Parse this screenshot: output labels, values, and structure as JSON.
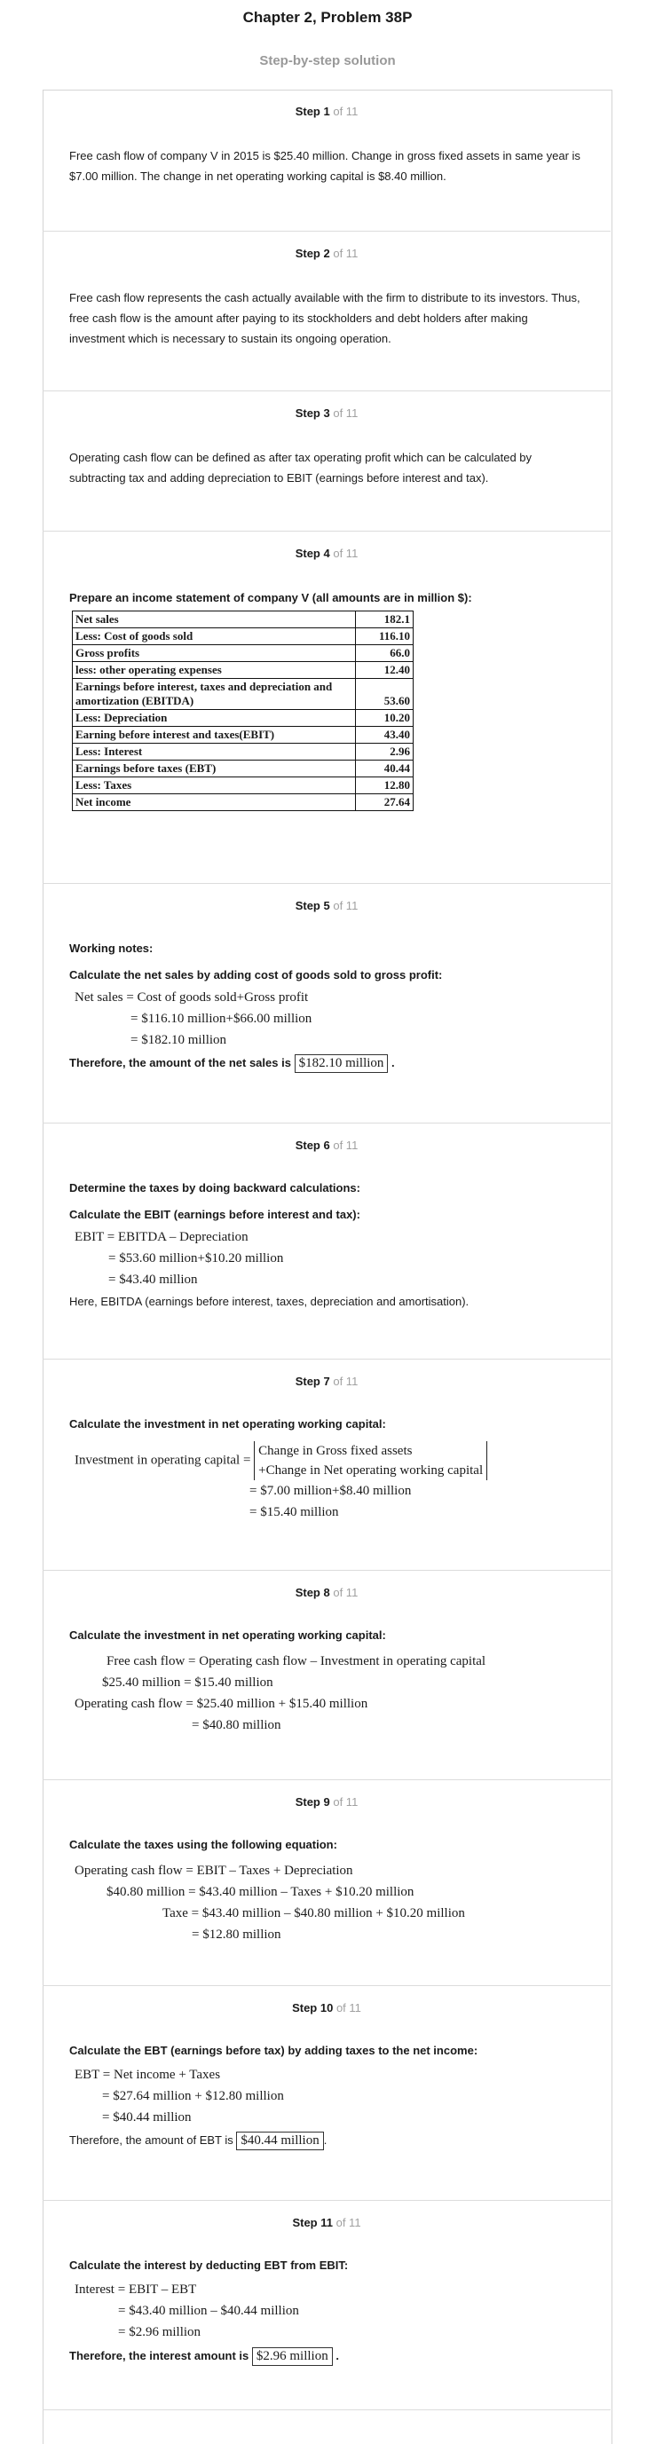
{
  "title": "Chapter 2, Problem 38P",
  "subtitle": "Step-by-step solution",
  "of_total": "of 11",
  "steps": [
    {
      "num": "Step 1",
      "text": "Free cash flow of company V in 2015 is $25.40 million. Change in gross fixed assets in same year is $7.00 million. The change in net operating working capital is $8.40 million."
    },
    {
      "num": "Step 2",
      "text": "Free cash flow represents the cash actually available with the firm to distribute to its investors. Thus, free cash flow is the amount after paying to its stockholders and debt holders after making investment which is necessary to sustain its ongoing operation."
    },
    {
      "num": "Step 3",
      "text": "Operating cash flow can be defined as after tax operating profit which can be calculated by subtracting tax and adding depreciation to EBIT (earnings before interest and tax)."
    },
    {
      "num": "Step 4",
      "heading": "Prepare an income statement of company V (all amounts are in million $):",
      "table": [
        {
          "label": "Net sales",
          "value": "182.1"
        },
        {
          "label": "Less: Cost of goods sold",
          "value": "116.10"
        },
        {
          "label": "Gross profits",
          "value": "66.0"
        },
        {
          "label": "less: other operating expenses",
          "value": "12.40"
        },
        {
          "label": "Earnings before interest, taxes and depreciation and amortization (EBITDA)",
          "value": "53.60"
        },
        {
          "label": "Less: Depreciation",
          "value": "10.20"
        },
        {
          "label": "Earning before interest and taxes(EBIT)",
          "value": "43.40"
        },
        {
          "label": "Less: Interest",
          "value": "2.96"
        },
        {
          "label": "Earnings before taxes (EBT)",
          "value": "40.44"
        },
        {
          "label": "Less: Taxes",
          "value": "12.80"
        },
        {
          "label": "Net income",
          "value": "27.64"
        }
      ]
    },
    {
      "num": "Step 5",
      "h1": "Working notes:",
      "h2": "Calculate the net sales by adding cost of goods sold to gross profit:",
      "lines": [
        "Net sales = Cost of goods sold+Gross profit",
        "= $116.10 million+$66.00 million",
        "= $182.10 million"
      ],
      "concl": "Therefore, the amount of the net sales is",
      "answer": "$182.10 million"
    },
    {
      "num": "Step 6",
      "h1": "Determine the taxes by doing backward calculations:",
      "h2": "Calculate the EBIT (earnings before interest and tax):",
      "lines": [
        "EBIT = EBITDA – Depreciation",
        "= $53.60 million+$10.20 million",
        "= $43.40 million"
      ],
      "note": "Here, EBITDA (earnings before interest, taxes, depreciation and amortisation)."
    },
    {
      "num": "Step 7",
      "h1": "Calculate the investment in net operating working capital:",
      "lhs": "Investment in operating capital =",
      "brack": [
        "Change in Gross fixed assets",
        "+Change in Net operating working capital"
      ],
      "lines": [
        "= $7.00 million+$8.40 million",
        "= $15.40 million"
      ]
    },
    {
      "num": "Step 8",
      "h1": "Calculate the investment in net operating working capital:",
      "lines": [
        "Free cash flow = Operating cash flow – Investment in operating capital",
        "$25.40  million = $15.40 million",
        "Operating cash flow = $25.40  million + $15.40 million",
        "= $40.80 million"
      ]
    },
    {
      "num": "Step 9",
      "h1": "Calculate the taxes using the following equation:",
      "lines": [
        "Operating cash flow = EBIT – Taxes + Depreciation",
        "$40.80 million = $43.40  million – Taxes + $10.20 million",
        "Taxe = $43.40  million – $40.80 million + $10.20 million",
        "= $12.80 million"
      ]
    },
    {
      "num": "Step 10",
      "h1": "Calculate the EBT (earnings before tax) by adding taxes to the net income:",
      "lines": [
        "EBT = Net income + Taxes",
        "= $27.64 million + $12.80 million",
        "= $40.44 million"
      ],
      "concl": "Therefore, the amount of EBT is",
      "answer": "$40.44 million"
    },
    {
      "num": "Step 11",
      "h1": "Calculate the interest by deducting EBT from EBIT:",
      "lines": [
        "Interest = EBIT – EBT",
        "= $43.40 million – $40.44 million",
        "= $2.96  million"
      ],
      "concl": "Therefore, the interest amount is",
      "answer": "$2.96  million"
    }
  ]
}
